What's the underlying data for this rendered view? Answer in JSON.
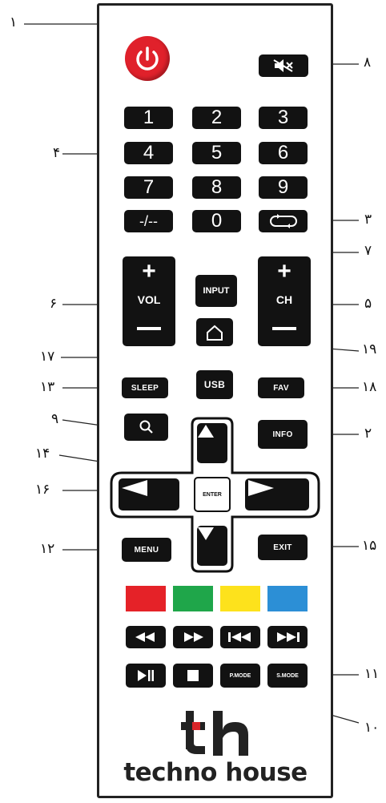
{
  "callouts": {
    "c1": "۱",
    "c2": "۲",
    "c3": "۳",
    "c4": "۴",
    "c5": "۵",
    "c6": "۶",
    "c7": "۷",
    "c8": "۸",
    "c9": "۹",
    "c10": "۱۰",
    "c11": "۱۱",
    "c12": "۱۲",
    "c13": "۱۳",
    "c14": "۱۴",
    "c15": "۱۵",
    "c16": "۱۶",
    "c17": "۱۷",
    "c18": "۱۸",
    "c19": "۱۹"
  },
  "numpad": [
    "1",
    "2",
    "3",
    "4",
    "5",
    "6",
    "7",
    "8",
    "9",
    "-/--",
    "0"
  ],
  "buttons": {
    "input": "INPUT",
    "vol": "VOL",
    "ch": "CH",
    "plus": "+",
    "usb": "USB",
    "sleep": "SLEEP",
    "fav": "FAV",
    "info": "INFO",
    "enter": "ENTER",
    "menu": "MENU",
    "exit": "EXIT",
    "pmode": "P.MODE",
    "smode": "S.MODE"
  },
  "color_keys": [
    "#e52228",
    "#1fa64a",
    "#fde21c",
    "#2c8fd6"
  ],
  "accent": {
    "power": "#e0212b",
    "logo_dot": "#d9252a",
    "button": "#121212"
  },
  "icons": [
    "power-icon",
    "mute-icon",
    "recall-icon",
    "home-icon",
    "search-icon",
    "rewind-icon",
    "fast-forward-icon",
    "previous-icon",
    "next-icon",
    "play-pause-icon",
    "stop-icon"
  ],
  "brand": {
    "mark": "th",
    "name": "techno house"
  }
}
